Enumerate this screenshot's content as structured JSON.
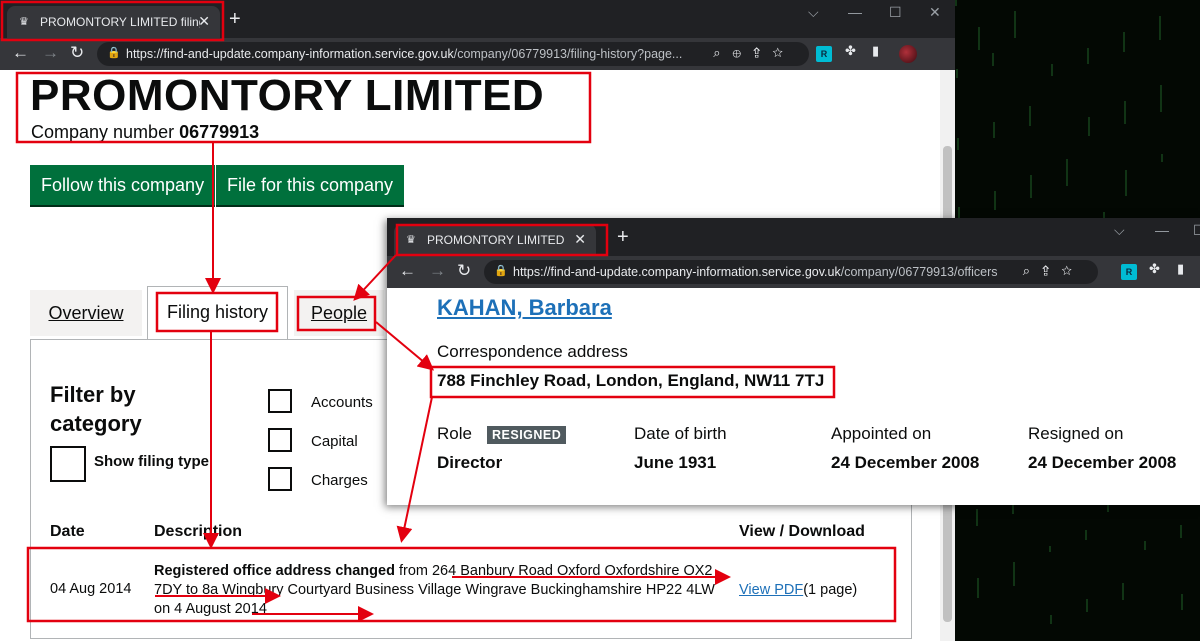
{
  "window1": {
    "tab_title": "PROMONTORY LIMITED filing his",
    "tab_close": "✕",
    "new_tab": "+",
    "url_host": "https://find-and-update.company-information.service.gov.uk",
    "url_path": "/company/06779913/filing-history?page...",
    "page": {
      "company_name": "PROMONTORY LIMITED",
      "company_number_label": "Company number",
      "company_number": "06779913",
      "follow_button": "Follow this company",
      "file_button": "File for this company",
      "tabs": [
        {
          "label": "Overview"
        },
        {
          "label": "Filing history"
        },
        {
          "label": "People"
        }
      ],
      "filter_heading": "Filter by category",
      "show_filing_type": "Show filing type",
      "categories": [
        "Accounts",
        "Capital",
        "Charges"
      ],
      "table": {
        "headers": {
          "date": "Date",
          "description": "Description",
          "view": "View / Download"
        },
        "row": {
          "date": "04 Aug 2014",
          "desc_bold": "Registered office address changed",
          "desc_rest": " from 264 Banbury Road Oxford Oxfordshire OX2 7DY to 8a Wingbury Courtyard Business Village Wingrave Buckinghamshire HP22 4LW on 4 August 2014",
          "pdf_link": "View PDF",
          "pdf_pages": "(1 page)"
        }
      }
    }
  },
  "window2": {
    "tab_title": "PROMONTORY LIMITED people -",
    "tab_close": "✕",
    "new_tab": "+",
    "url_host": "https://find-and-update.company-information.service.gov.uk",
    "url_path": "/company/06779913/officers",
    "page": {
      "officer_name": "KAHAN, Barbara",
      "correspondence_label": "Correspondence address",
      "correspondence_address": "788 Finchley Road, London, England, NW11 7TJ",
      "role_label": "Role",
      "resigned_tag": "RESIGNED",
      "role_value": "Director",
      "dob_label": "Date of birth",
      "dob_value": "June 1931",
      "appointed_label": "Appointed on",
      "appointed_value": "24 December 2008",
      "resigned_label": "Resigned on",
      "resigned_value": "24 December 2008"
    }
  },
  "icons": {
    "back": "←",
    "forward": "→",
    "reload": "↻",
    "lock": "🔒",
    "crown": "♛",
    "minimize": "—",
    "maximize": "☐",
    "close": "✕",
    "chevron": "⌵"
  },
  "colors": {
    "annotation_red": "#e3000f",
    "govuk_green": "#00703c",
    "govuk_link": "#1d70b8",
    "chrome_dark": "#202124",
    "chrome_toolbar": "#35363a"
  }
}
